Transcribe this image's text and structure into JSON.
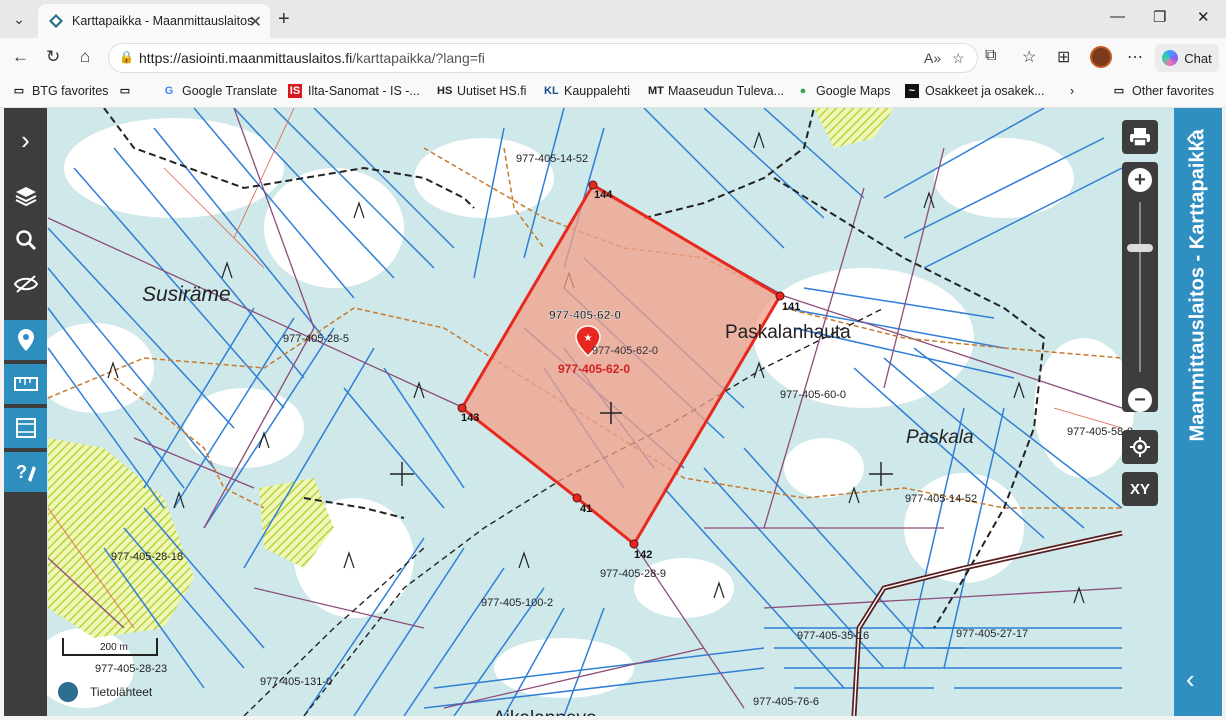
{
  "browser": {
    "tab_title": "Karttapaikka - Maanmittauslaitos",
    "url_host": "https://asiointi.maanmittauslaitos.fi",
    "url_path": "/karttapaikka/?lang=fi",
    "chat_label": "Chat"
  },
  "bookmarks": [
    {
      "label": "BTG favorites",
      "icon": "folder-icon"
    },
    {
      "label": "Google Translate",
      "icon": "translate-icon"
    },
    {
      "label": "Ilta-Sanomat - IS -...",
      "icon": "is-logo"
    },
    {
      "label": "Uutiset HS.fi",
      "icon": "hs-logo"
    },
    {
      "label": "Kauppalehti",
      "icon": "kl-logo"
    },
    {
      "label": "Maaseudun Tuleva...",
      "icon": "mt-logo"
    },
    {
      "label": "Google Maps",
      "icon": "maps-pin-icon"
    },
    {
      "label": "Osakkeet ja osakek...",
      "icon": "stock-icon"
    }
  ],
  "other_favorites": "Other favorites",
  "map": {
    "side_title": "Maanmittauslaitos - Karttapaikka",
    "place_names": [
      "Susiräme",
      "Paskalanhauta",
      "Paskala",
      "Aikalannevo"
    ],
    "parcel_labels": [
      "977-405-14-52",
      "977-405-28-5",
      "977-405-60-0",
      "977-405-58-0",
      "977-405-14-52",
      "977-405-28-18",
      "977-405-28-9",
      "977-405-100-2",
      "977-405-35-16",
      "977-405-27-17",
      "977-405-28-23",
      "977-405-131-0",
      "977-405-76-6"
    ],
    "selected_parcel_label": "977-405-62-0",
    "selected_parcel_small": "977-405-62-0",
    "selected_parcel_red": "977-405-62-0",
    "boundary_points": [
      "144",
      "141",
      "143",
      "41",
      "142"
    ],
    "scale_label": "200 m",
    "sources_label": "Tietolähteet",
    "xy_label": "XY",
    "colors": {
      "selection_fill": "#f4a08a",
      "selection_stroke": "#e8281e",
      "ditch": "#2f7fd6",
      "panel": "#2f8fc0"
    }
  }
}
